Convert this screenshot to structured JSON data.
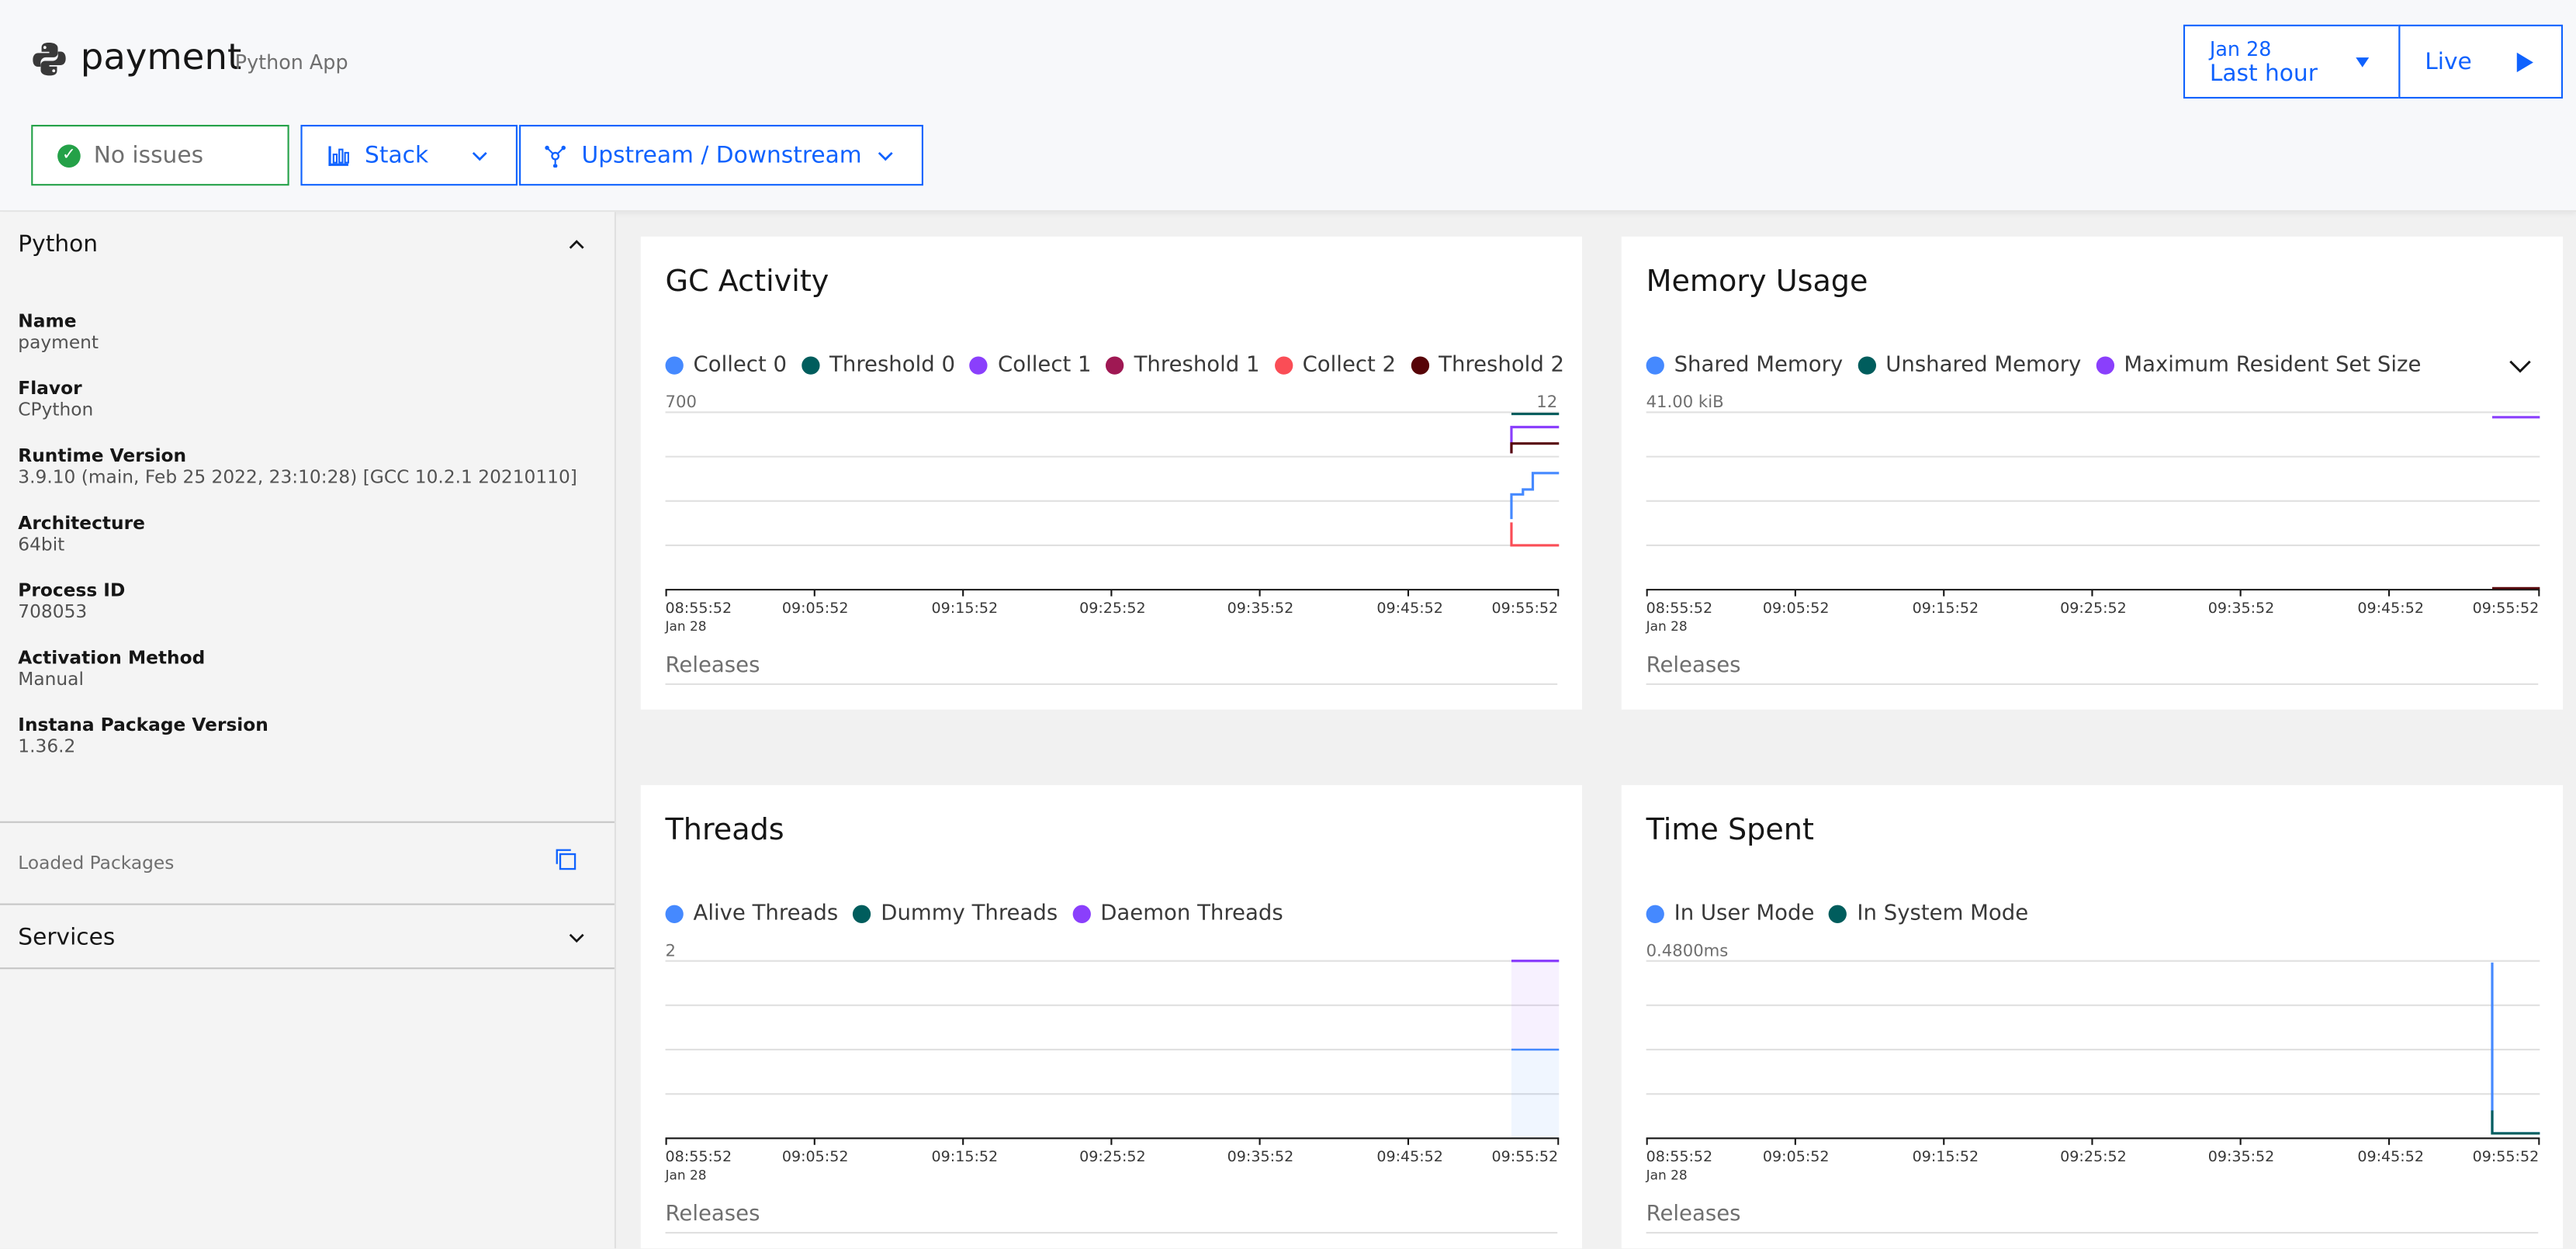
{
  "header": {
    "app_name": "payment",
    "app_type": "Python App",
    "status_label": "No issues",
    "stack_label": "Stack",
    "upstream_label": "Upstream / Downstream",
    "date_line1": "Jan 28",
    "date_line2": "Last hour",
    "live_label": "Live"
  },
  "sidebar": {
    "section_title": "Python",
    "properties": [
      {
        "label": "Name",
        "value": "payment"
      },
      {
        "label": "Flavor",
        "value": "CPython"
      },
      {
        "label": "Runtime Version",
        "value": "3.9.10 (main, Feb 25 2022, 23:10:28) [GCC 10.2.1 20210110]"
      },
      {
        "label": "Architecture",
        "value": "64bit"
      },
      {
        "label": "Process ID",
        "value": "708053"
      },
      {
        "label": "Activation Method",
        "value": "Manual"
      },
      {
        "label": "Instana Package Version",
        "value": "1.36.2"
      }
    ],
    "loaded_packages": "Loaded Packages",
    "services": "Services"
  },
  "x_ticks": [
    "08:55:52",
    "09:05:52",
    "09:15:52",
    "09:25:52",
    "09:35:52",
    "09:45:52",
    "09:55:52"
  ],
  "x_date": "Jan 28",
  "releases_label": "Releases",
  "charts": {
    "gc": {
      "title": "GC Activity",
      "ymax": "700",
      "ymax_right": "12",
      "legend": [
        {
          "name": "Collect 0",
          "color": "#4589ff"
        },
        {
          "name": "Threshold 0",
          "color": "#005d5d"
        },
        {
          "name": "Collect 1",
          "color": "#8a3ffc"
        },
        {
          "name": "Threshold 1",
          "color": "#9f1853"
        },
        {
          "name": "Collect 2",
          "color": "#fa4d56"
        },
        {
          "name": "Threshold 2",
          "color": "#570408"
        }
      ]
    },
    "memory": {
      "title": "Memory Usage",
      "ymax": "41.00 kiB",
      "legend": [
        {
          "name": "Shared Memory",
          "color": "#4589ff"
        },
        {
          "name": "Unshared Memory",
          "color": "#005d5d"
        },
        {
          "name": "Maximum Resident Set Size",
          "color": "#8a3ffc"
        }
      ]
    },
    "threads": {
      "title": "Threads",
      "ymax": "2",
      "legend": [
        {
          "name": "Alive Threads",
          "color": "#4589ff"
        },
        {
          "name": "Dummy Threads",
          "color": "#005d5d"
        },
        {
          "name": "Daemon Threads",
          "color": "#8a3ffc"
        }
      ]
    },
    "time": {
      "title": "Time Spent",
      "ymax": "0.4800ms",
      "legend": [
        {
          "name": "In User Mode",
          "color": "#4589ff"
        },
        {
          "name": "In System Mode",
          "color": "#005d5d"
        }
      ]
    }
  }
}
